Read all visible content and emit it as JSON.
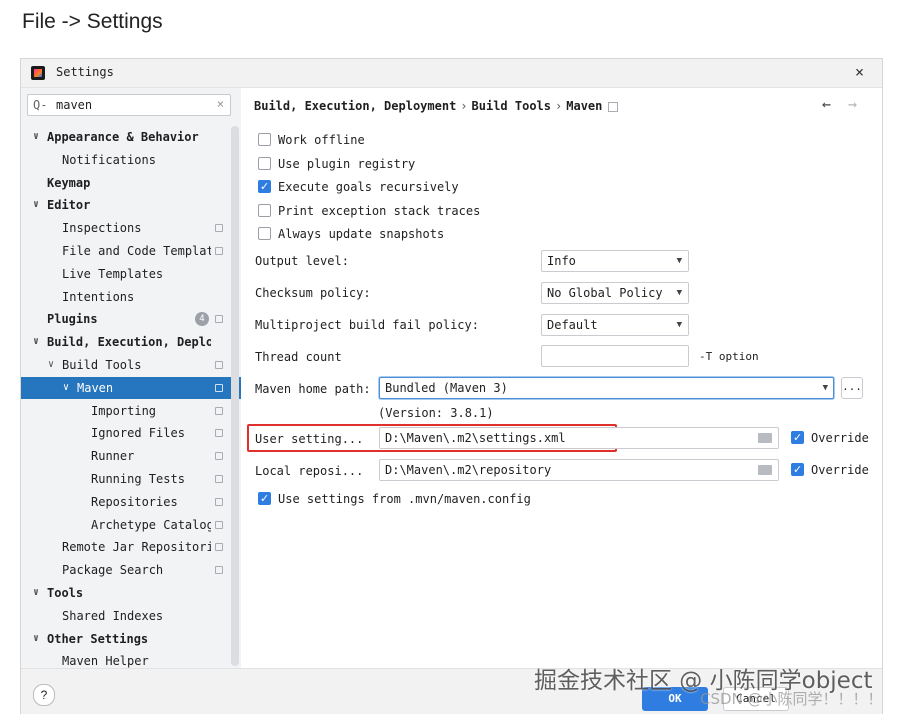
{
  "caption": "File -> Settings",
  "window": {
    "title": "Settings",
    "close": "×"
  },
  "search": {
    "value": "maven",
    "icon": "Q-",
    "clear": "×"
  },
  "tree": [
    {
      "label": "Appearance & Behavior",
      "bold": true,
      "chevron": "∨"
    },
    {
      "label": "Notifications"
    },
    {
      "label": "Keymap",
      "bold": true
    },
    {
      "label": "Editor",
      "bold": true,
      "chevron": "∨"
    },
    {
      "label": "Inspections",
      "marker": true
    },
    {
      "label": "File and Code Templates",
      "marker": true
    },
    {
      "label": "Live Templates"
    },
    {
      "label": "Intentions"
    },
    {
      "label": "Plugins",
      "bold": true,
      "badge": "4",
      "marker": true
    },
    {
      "label": "Build, Execution, Deploym",
      "bold": true,
      "chevron": "∨"
    },
    {
      "label": "Build Tools",
      "chevron": "∨",
      "marker": true
    },
    {
      "label": "Maven",
      "chevron": "∨",
      "marker": true,
      "selected": true
    },
    {
      "label": "Importing",
      "marker": true
    },
    {
      "label": "Ignored Files",
      "marker": true
    },
    {
      "label": "Runner",
      "marker": true
    },
    {
      "label": "Running Tests",
      "marker": true
    },
    {
      "label": "Repositories",
      "marker": true
    },
    {
      "label": "Archetype Catalog",
      "marker": true
    },
    {
      "label": "Remote Jar Repositorie",
      "marker": true
    },
    {
      "label": "Package Search",
      "marker": true
    },
    {
      "label": "Tools",
      "bold": true,
      "chevron": "∨"
    },
    {
      "label": "Shared Indexes"
    },
    {
      "label": "Other Settings",
      "bold": true,
      "chevron": "∨"
    },
    {
      "label": "Maven Helper"
    }
  ],
  "breadcrumb": {
    "part1": "Build, Execution, Deployment",
    "sep": "›",
    "part2": "Build Tools",
    "part3": "Maven"
  },
  "nav": {
    "back": "←",
    "forward": "→"
  },
  "checkboxes": {
    "work_offline": "Work offline",
    "use_plugin_registry": "Use plugin registry",
    "execute_goals": "Execute goals recursively",
    "print_exception": "Print exception stack traces",
    "always_update": "Always update snapshots",
    "use_mvn_config": "Use settings from .mvn/maven.config"
  },
  "fields": {
    "output_level_label": "Output level:",
    "output_level_value": "Info",
    "checksum_label": "Checksum policy:",
    "checksum_value": "No Global Policy",
    "multiproject_label": "Multiproject build fail policy:",
    "multiproject_value": "Default",
    "thread_count_label": "Thread count",
    "thread_count_value": "",
    "thread_count_note": "-T option",
    "maven_home_label": "Maven home path:",
    "maven_home_value": "Bundled (Maven 3)",
    "browse_label": "...",
    "version_note": "(Version: 3.8.1)",
    "user_settings_label": "User setting...",
    "user_settings_value": "D:\\Maven\\.m2\\settings.xml",
    "local_repo_label": "Local reposi...",
    "local_repo_value": "D:\\Maven\\.m2\\repository",
    "override_label": "Override",
    "arrow": "▼"
  },
  "footer": {
    "help": "?",
    "ok": "OK",
    "cancel": "Cancel"
  },
  "watermark": {
    "line1": "掘金技术社区 @ 小陈同学object",
    "line2": "CSDN @小陈同学！！！！"
  },
  "colors": {
    "accent": "#2f7de1",
    "selection": "#2675bf",
    "highlight": "#e0302c"
  }
}
